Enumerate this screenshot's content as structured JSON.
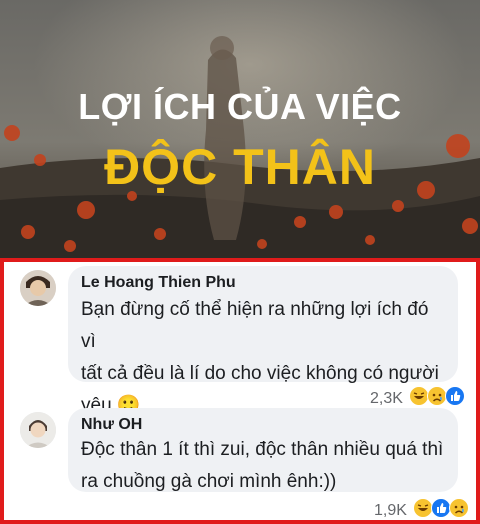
{
  "banner": {
    "title_line1": "LỢI ÍCH CỦA VIỆC",
    "title_line2": "ĐỘC THÂN"
  },
  "comments": [
    {
      "author": "Le Hoang Thien Phu",
      "lines": [
        "Bạn đừng cố thể hiện ra những lợi ích đó vì",
        "tất cả đều là lí do cho việc không có người",
        "yêu"
      ],
      "emoji": "🙂",
      "reaction_count": "2,3K",
      "reaction_icons": [
        "haha-icon",
        "sad-icon",
        "like-icon"
      ]
    },
    {
      "author": "Như OH",
      "lines": [
        "Độc thân 1 ít thì zui, độc thân nhiều quá thì",
        "ra chuồng gà chơi mình ênh:))"
      ],
      "reaction_count": "1,9K",
      "reaction_icons": [
        "haha-icon",
        "like-icon",
        "sad-icon"
      ]
    }
  ],
  "colors": {
    "highlight_border": "#e01b1b",
    "title_accent": "#f3c219",
    "bubble_bg": "#eff1f4"
  }
}
